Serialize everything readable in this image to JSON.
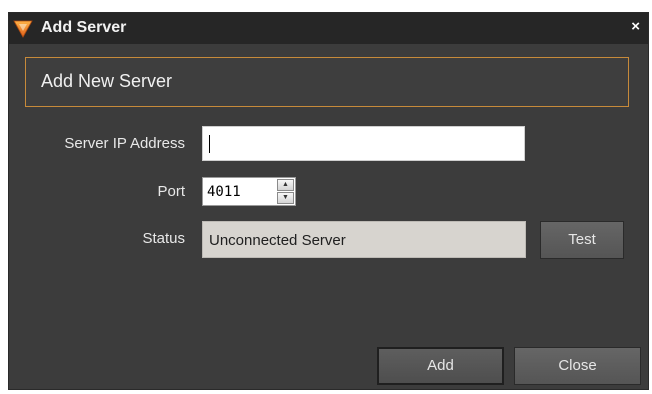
{
  "window": {
    "title": "Add Server",
    "close_glyph": "×",
    "accent": "#c78a3a"
  },
  "header": {
    "text": "Add New Server"
  },
  "form": {
    "ip_label": "Server IP Address",
    "ip_value": "",
    "port_label": "Port",
    "port_value": "4011",
    "status_label": "Status",
    "status_value": "Unconnected Server",
    "test_label": "Test"
  },
  "footer": {
    "add_label": "Add",
    "close_label": "Close"
  }
}
